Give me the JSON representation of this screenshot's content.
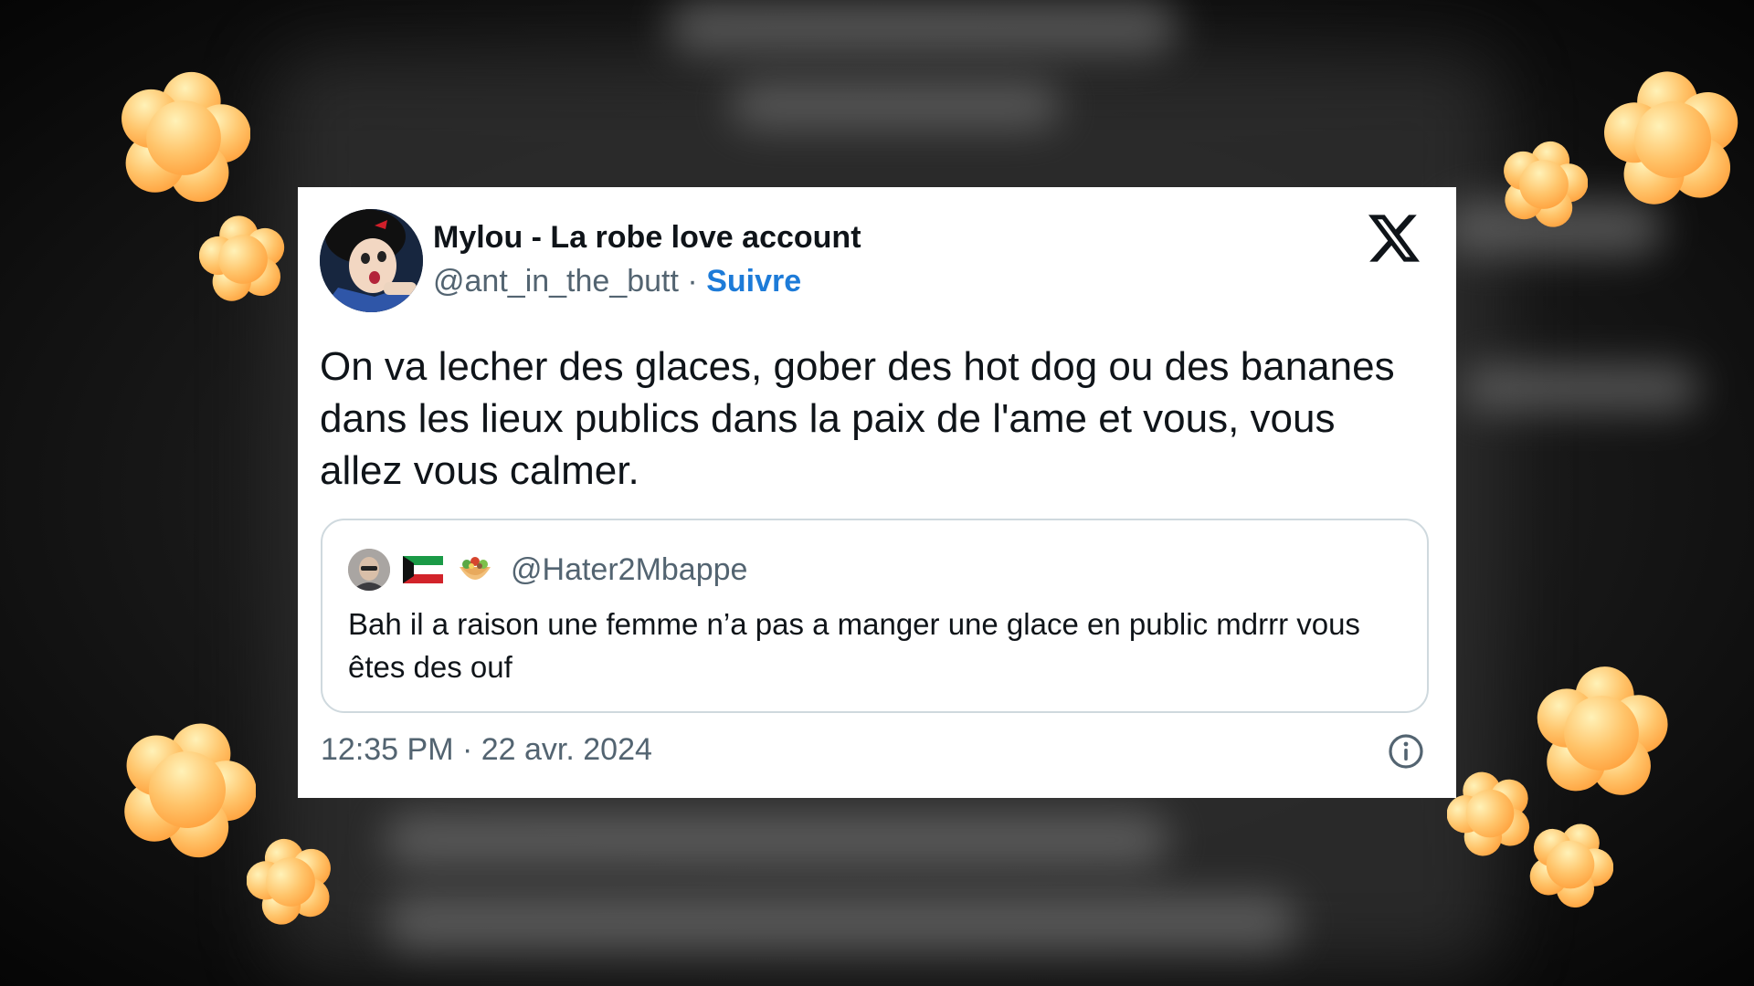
{
  "tweet": {
    "display_name": "Mylou - La robe love account",
    "handle": "@ant_in_the_butt",
    "separator": "·",
    "follow_label": "Suivre",
    "text": "On va lecher des glaces, gober des hot dog ou des bananes dans les lieux publics dans la paix de l'ame et vous, vous allez vous calmer.",
    "timestamp": "12:35 PM · 22 avr. 2024",
    "platform_icon": "x-logo-icon",
    "info_icon": "info-icon"
  },
  "quote": {
    "handle": "@Hater2Mbappe",
    "flag_icon": "kuwait-flag-icon",
    "emoji_icon": "burrito-emoji-icon",
    "text": "Bah il a raison une femme n’a pas a manger une glace en public mdrrr vous êtes des ouf"
  },
  "colors": {
    "link_blue": "#1d7bd8",
    "secondary_text": "#536471",
    "flower_orange": "#ffb347",
    "flower_light": "#ffe9a8"
  }
}
